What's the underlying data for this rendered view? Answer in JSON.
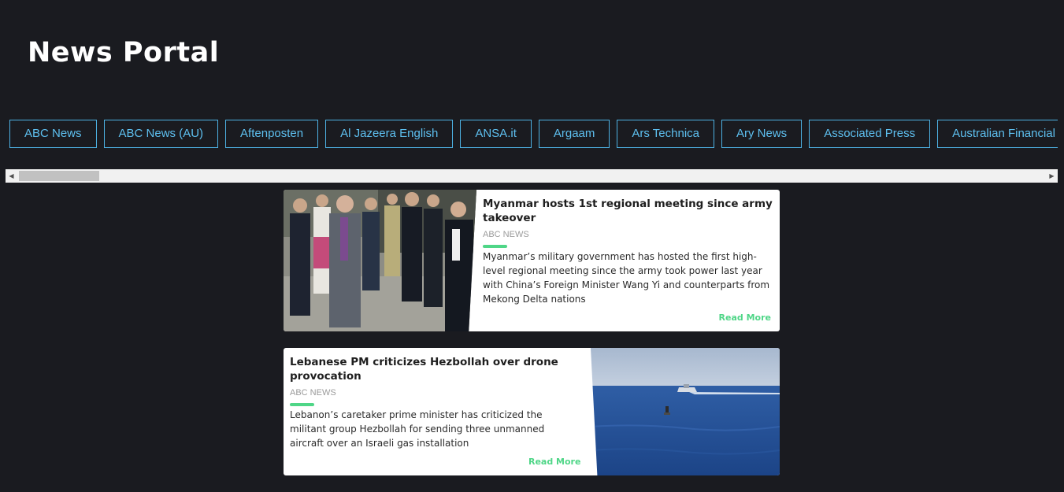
{
  "header": {
    "title": "News Portal"
  },
  "sources": [
    "ABC News",
    "ABC News (AU)",
    "Aftenposten",
    "Al Jazeera English",
    "ANSA.it",
    "Argaam",
    "Ars Technica",
    "Ary News",
    "Associated Press",
    "Australian Financial Review"
  ],
  "articles": [
    {
      "title": "Myanmar hosts 1st regional meeting since army takeover",
      "source": "ABC NEWS",
      "description": "Myanmar’s military government has hosted the first high-level regional meeting since the army took power last year with China’s Foreign Minister Wang Yi and counterparts from Mekong Delta nations",
      "read_more": "Read More"
    },
    {
      "title": "Lebanese PM criticizes Hezbollah over drone provocation",
      "source": "ABC NEWS",
      "description": "Lebanon’s caretaker prime minister has criticized the militant group Hezbollah for sending three unmanned aircraft over an Israeli gas installation",
      "read_more": "Read More"
    }
  ],
  "colors": {
    "background": "#1a1b20",
    "source_button": "#5ec0f0",
    "accent": "#4fd687"
  }
}
